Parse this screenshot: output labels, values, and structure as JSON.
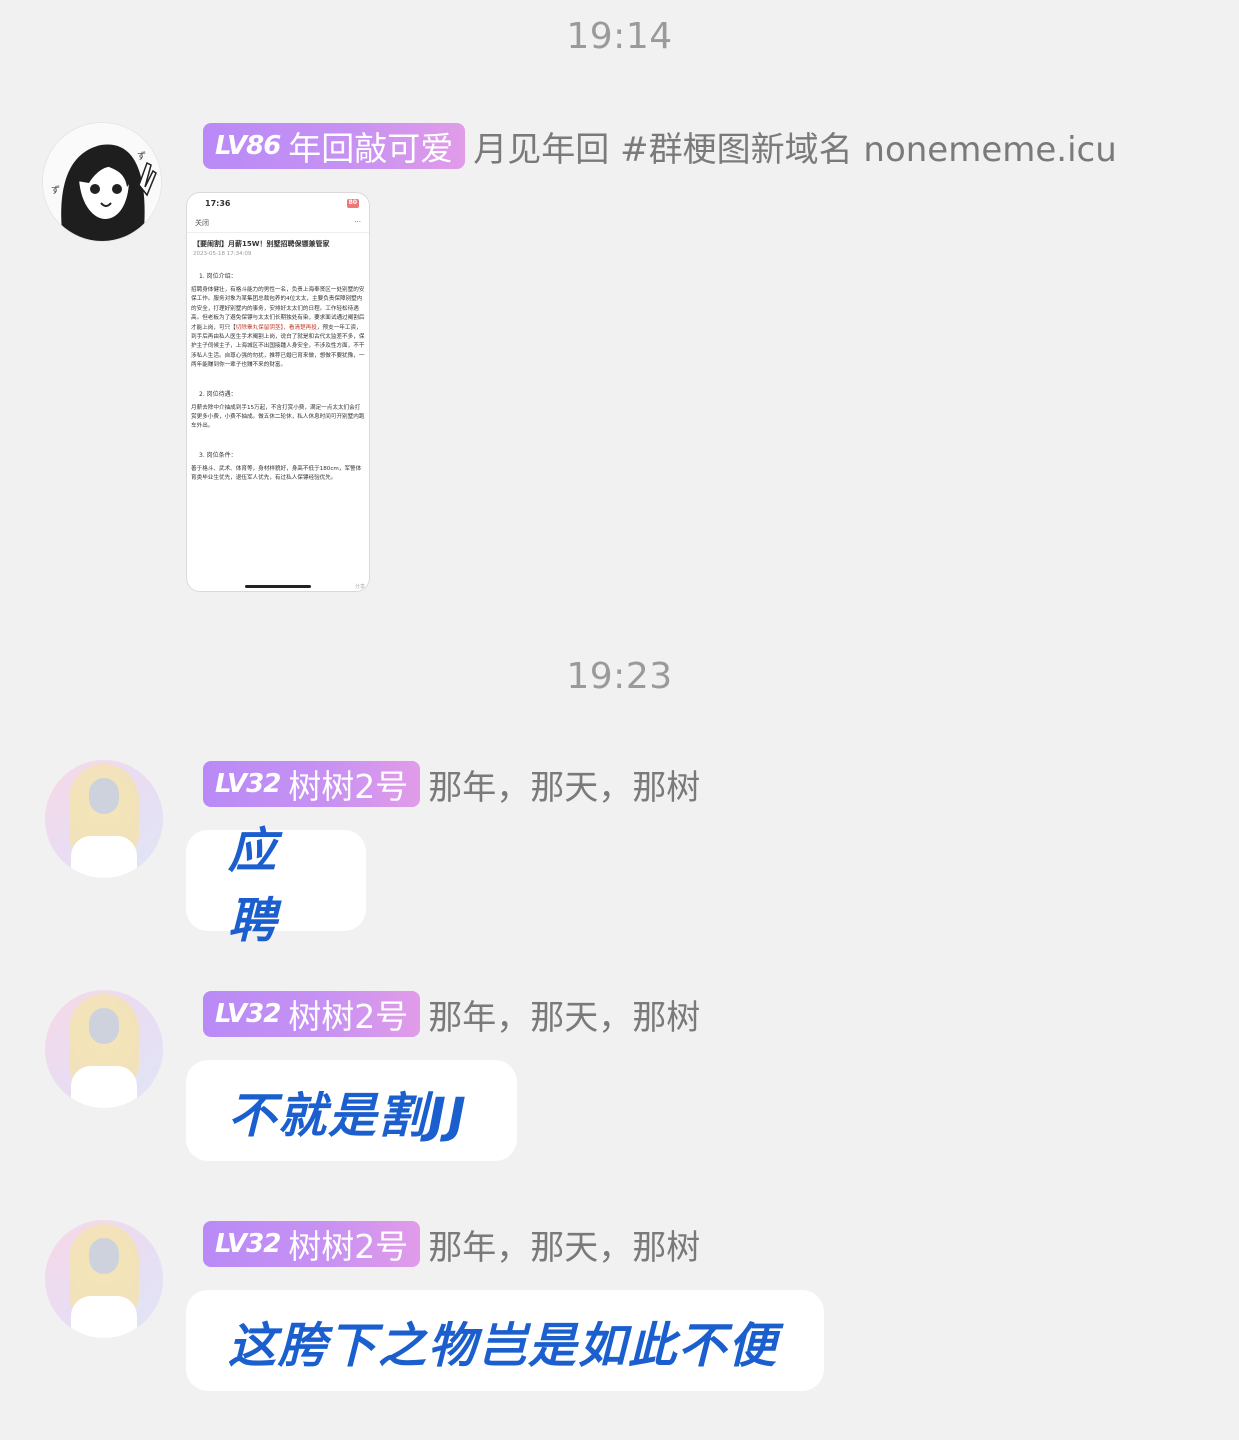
{
  "timestamps": [
    "19:14",
    "19:23"
  ],
  "messages": [
    {
      "level": "LV86",
      "name": "年回敲可爱",
      "title": "月见年回 #群梗图新域名 nonememe.icu",
      "type": "image",
      "image": {
        "time": "17:36",
        "battery": "80",
        "close_label": "关闭",
        "more_label": "···",
        "article_title": "【要闹割】月薪15W！别墅招聘保镖兼管家",
        "article_date": "2023-05-18 17:34:09",
        "section1": "1. 岗位介绍：",
        "para1a": "招聘身体健壮，有格斗能力的男性一名，负责上海奉贤区一处别墅的安保工作。服务对象为某集团总裁包养的4位太太，主要负责保障别墅内的安全，打理好别墅内的事务，安排好太太们的日程。工作轻松待遇高。但老板为了避免保镖与太太们长期独处有染，要求面试通过阉割后才能上岗，可只【",
        "para1red": "切除睾丸保留阴茎】，看清楚再投",
        "para1b": "，预支一年工资，到手后再由私人医生手术阉割上岗，说白了就是和古代太监差不多，保护主子伺候主子，上海城区不出国接踵人身安全，不涉及性方面，不干涉私人生活。自尊心强的勿扰，推荐已婚已育来做，想做不要犹豫，一两年能赚到你一辈子也赚不来的财富。",
        "section2": "2. 岗位待遇：",
        "para2": "月薪去除中介抽成到手15万起，不含打赏小费，满足一点太太们会打赏更多小费，小费不抽成。做五休二轮休，私人休息时间可开别墅内跑车外出。",
        "section3": "3. 岗位条件：",
        "para3": "善于格斗、武术、体育等，身材样貌好，身高不低于180cm，军警体育类毕业生优先，退伍军人优先，有过私人保镖经验优先。",
        "corner": "分享"
      }
    },
    {
      "level": "LV32",
      "name": "树树2号",
      "title": "那年，那天，那树",
      "type": "text",
      "text": "应聘"
    },
    {
      "level": "LV32",
      "name": "树树2号",
      "title": "那年，那天，那树",
      "type": "text",
      "text": "不就是割JJ"
    },
    {
      "level": "LV32",
      "name": "树树2号",
      "title": "那年，那天，那树",
      "type": "text",
      "text": "这胯下之物岂是如此不便"
    }
  ],
  "colors": {
    "background": "#f1f1f1",
    "badge_gradient_start": "#b98af6",
    "badge_gradient_end": "#e19ce8",
    "bubble_text": "#1b5fce",
    "timestamp": "#9a9a9a",
    "title_text": "#7a7a7a"
  },
  "icons": [
    "manga-girl-avatar",
    "cosplay-girl-avatar"
  ]
}
